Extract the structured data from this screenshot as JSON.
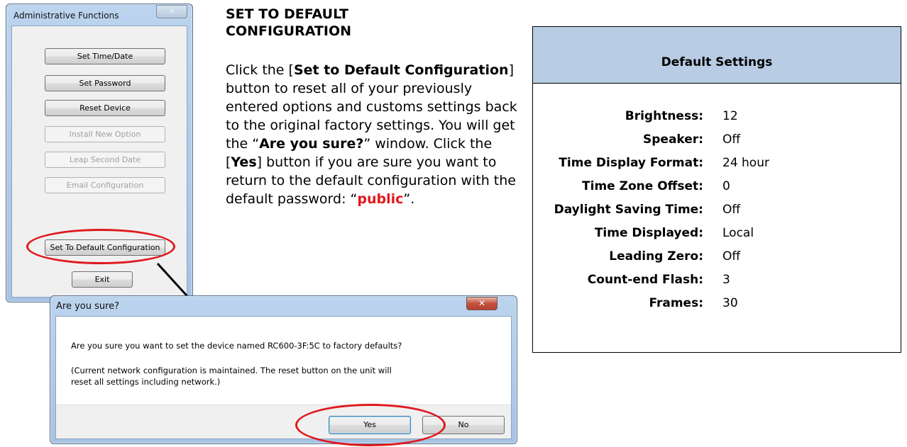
{
  "admin_window": {
    "title": "Administrative Functions",
    "close_glyph": "✕",
    "buttons": [
      {
        "label": "Set Time/Date",
        "enabled": true
      },
      {
        "label": "Set Password",
        "enabled": true
      },
      {
        "label": "Reset Device",
        "enabled": true
      },
      {
        "label": "Install New Option",
        "enabled": false
      },
      {
        "label": "Leap Second Date",
        "enabled": false
      },
      {
        "label": "Email Configuration",
        "enabled": false
      },
      {
        "label": "Set To Default Configuration",
        "enabled": true
      },
      {
        "label": "Exit",
        "enabled": true
      }
    ]
  },
  "instructions": {
    "heading": "SET TO DEFAULT CONFIGURATION",
    "t1": "Click the [",
    "b1": "Set to Default Configuration",
    "t2": "] button to reset all of your previously entered options and customs settings back to the original factory settings. You will get the “",
    "b2": "Are you sure?",
    "t3": "” window. Click the [",
    "b3": "Yes",
    "t4": "] button if you are sure you want to return to the default configuration with the default password: “",
    "password": "public",
    "t5": "”."
  },
  "confirm_dialog": {
    "title": "Are you sure?",
    "close_glyph": "✕",
    "message": "Are you sure you want to set the device named RC600-3F:5C to factory defaults?",
    "note_line1": "(Current network configuration is maintained. The reset button on the unit will",
    "note_line2": "reset all settings including network.)",
    "yes_label": "Yes",
    "no_label": "No"
  },
  "default_settings": {
    "title": "Default Settings",
    "rows": [
      {
        "label": "Brightness:",
        "value": "12"
      },
      {
        "label": "Speaker:",
        "value": "Off"
      },
      {
        "label": "Time Display Format:",
        "value": "24 hour"
      },
      {
        "label": "Time Zone Offset:",
        "value": "0"
      },
      {
        "label": "Daylight Saving Time:",
        "value": "Off"
      },
      {
        "label": "Time Displayed:",
        "value": "Local"
      },
      {
        "label": "Leading Zero:",
        "value": "Off"
      },
      {
        "label": "Count-end Flash:",
        "value": "3"
      },
      {
        "label": "Frames:",
        "value": "30"
      }
    ]
  },
  "colors": {
    "highlight_red": "#e0181d",
    "table_header": "#b8cce4"
  }
}
